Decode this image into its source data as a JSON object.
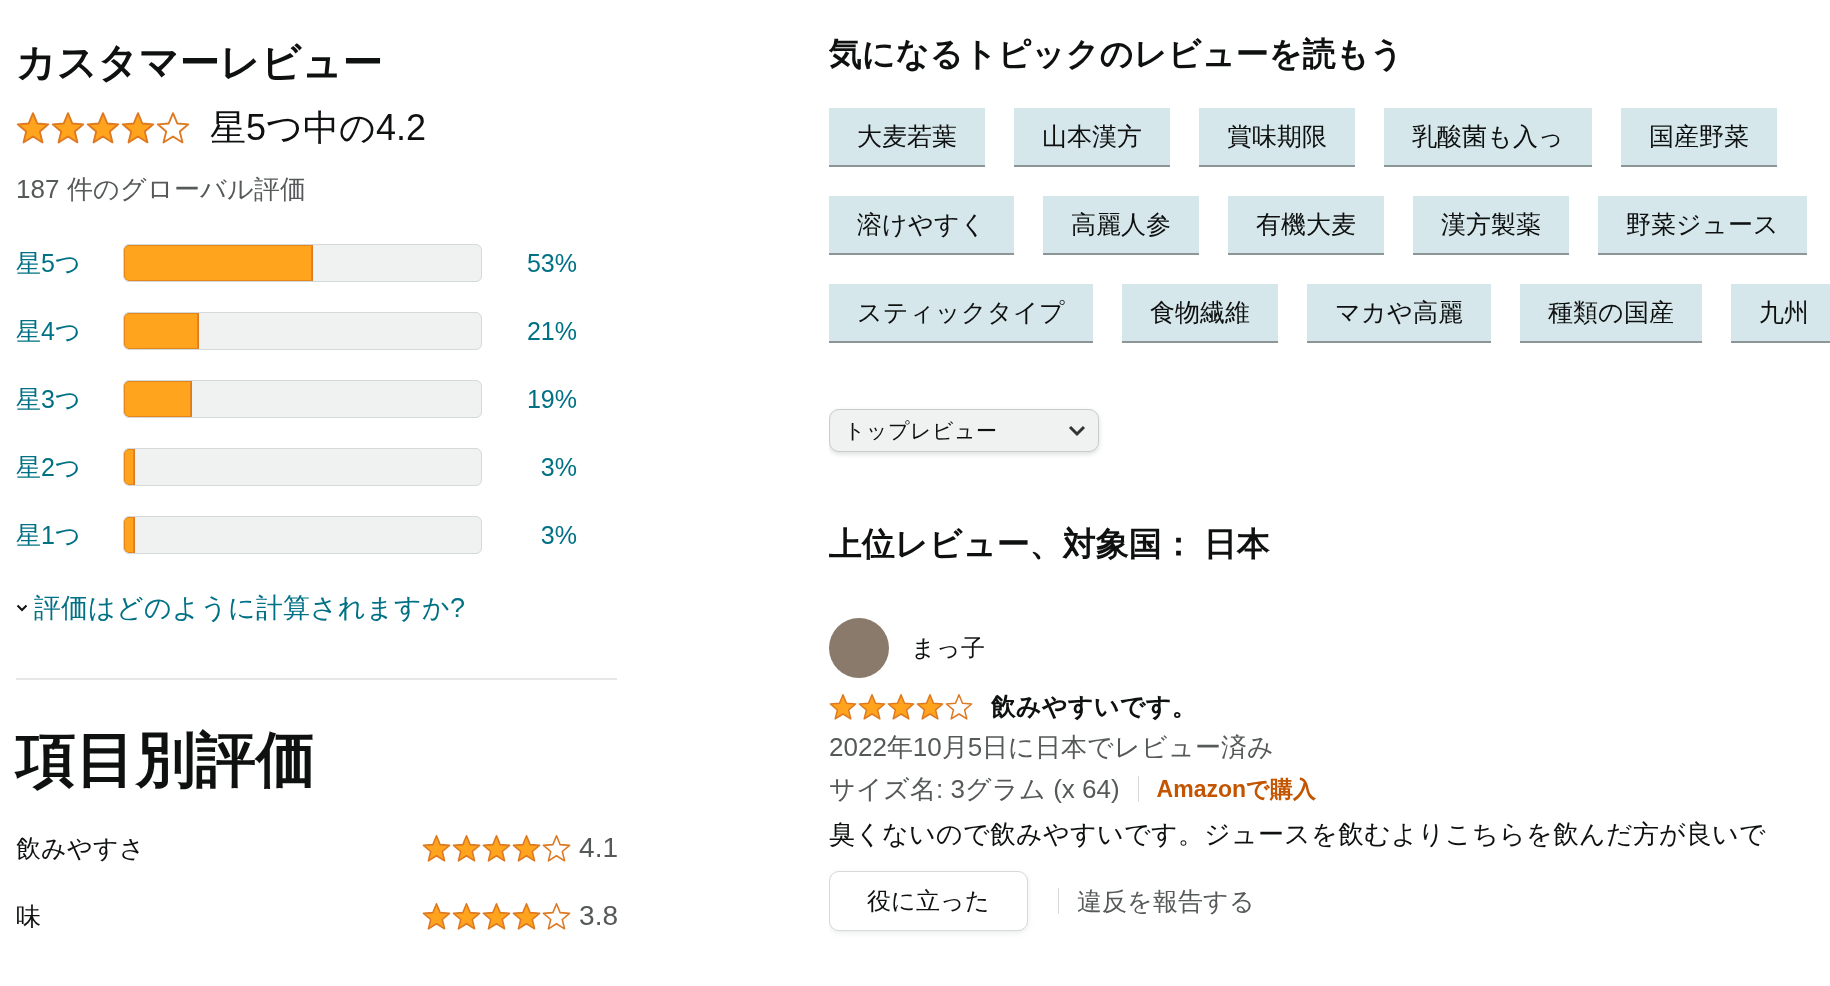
{
  "summary": {
    "title": "カスタマーレビュー",
    "stars": 4,
    "rating_text": "星5つ中の4.2",
    "global_count": "187 件のグローバル評価",
    "histogram": [
      {
        "label": "星5つ",
        "level": 0.53,
        "percent": "53%"
      },
      {
        "label": "星4つ",
        "level": 0.21,
        "percent": "21%"
      },
      {
        "label": "星3つ",
        "level": 0.19,
        "percent": "19%"
      },
      {
        "label": "星2つ",
        "level": 0.03,
        "percent": "3%"
      },
      {
        "label": "星1つ",
        "level": 0.03,
        "percent": "3%"
      }
    ],
    "help_link": "評価はどのように計算されますか?"
  },
  "by_feature": {
    "title": "項目別評価",
    "items": [
      {
        "name": "飲みやすさ",
        "stars": 4,
        "score": "4.1"
      },
      {
        "name": "味",
        "stars": 4,
        "score": "3.8"
      }
    ]
  },
  "topics": {
    "title": "気になるトピックのレビューを読もう",
    "rows": [
      [
        "大麦若葉",
        "山本漢方",
        "賞味期限",
        "乳酸菌も入っ",
        "国産野菜"
      ],
      [
        "溶けやすく",
        "高麗人参",
        "有機大麦",
        "漢方製薬",
        "野菜ジュース"
      ],
      [
        "スティックタイプ",
        "食物繊維",
        "マカや高麗",
        "種類の国産",
        "九州"
      ]
    ]
  },
  "sort": {
    "value": "トップレビュー"
  },
  "reviews": {
    "title": "上位レビュー、対象国： 日本",
    "items": [
      {
        "author": "まっ子",
        "stars": 4,
        "headline": "飲みやすいです。",
        "date": "2022年10月5日に日本でレビュー済み",
        "size": "サイズ名: 3グラム (x 64)",
        "badge": "Amazonで購入",
        "body": "臭くないので飲みやすいです。ジュースを飲むよりこちらを飲んだ方が良いで",
        "helpful_button": "役に立った",
        "report_link": "違反を報告する"
      }
    ]
  }
}
